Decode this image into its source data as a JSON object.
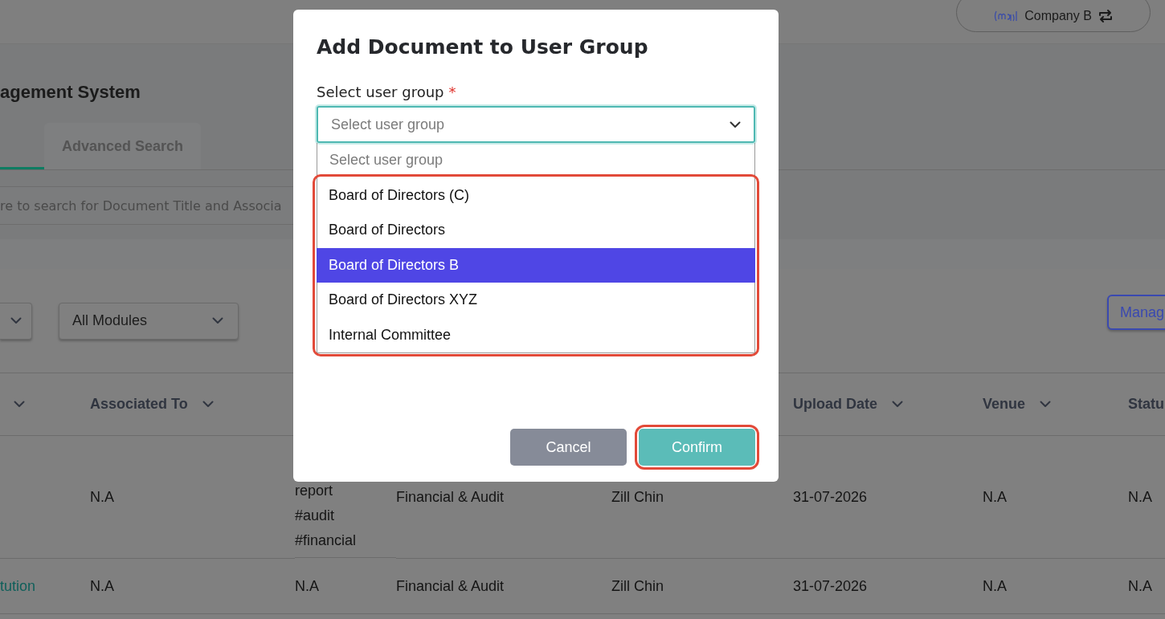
{
  "header": {
    "company": "Company B"
  },
  "page": {
    "title": "agement System",
    "tabs": [
      {
        "selected": true
      },
      {
        "label": "Advanced Search",
        "selected": false
      }
    ],
    "search": {
      "placeholder": "re to search for Document Title and Associa"
    },
    "module_filter": {
      "value": "All Modules"
    },
    "manage_button": "Manag"
  },
  "table": {
    "columns": [
      {
        "sortable": true
      },
      {
        "label": "Associated To",
        "sortable": true
      },
      {},
      {},
      {},
      {
        "label": "Upload Date",
        "sortable": true
      },
      {
        "label": "Venue",
        "sortable": true
      },
      {
        "label": "Statu",
        "sortable": false
      }
    ],
    "rows": [
      {
        "cells": [
          null,
          {
            "text": "N.A",
            "kind": "text"
          },
          {
            "text": "report\n#audit\n#financial",
            "kind": "text"
          },
          {
            "text": "Financial & Audit",
            "kind": "text"
          },
          {
            "text": "Zill Chin",
            "kind": "text"
          },
          {
            "text": "31-07-2026",
            "kind": "text"
          },
          {
            "text": "N.A",
            "kind": "text"
          },
          {
            "text": "N.A",
            "kind": "text"
          }
        ]
      },
      {
        "cells": [
          {
            "text": "tution",
            "kind": "link"
          },
          {
            "text": "N.A",
            "kind": "text"
          },
          {
            "text": "N.A",
            "kind": "text"
          },
          {
            "text": "Financial & Audit",
            "kind": "text"
          },
          {
            "text": "Zill Chin",
            "kind": "text"
          },
          {
            "text": "31-07-2026",
            "kind": "text"
          },
          {
            "text": "N.A",
            "kind": "text"
          },
          {
            "text": "N.A",
            "kind": "text"
          }
        ]
      }
    ]
  },
  "modal": {
    "title": "Add Document to User Group",
    "field_label": "Select user group",
    "required_mark": "*",
    "select": {
      "placeholder": "Select user group",
      "expanded": true
    },
    "options_highlighted": true,
    "options": [
      {
        "label": "Select user group",
        "kind": "placeholder",
        "selected": false
      },
      {
        "label": "Board of Directors (C)",
        "kind": "group",
        "selected": false
      },
      {
        "label": "Board of Directors",
        "kind": "group",
        "selected": false
      },
      {
        "label": "Board of Directors B",
        "kind": "group",
        "selected": true
      },
      {
        "label": "Board of Directors XYZ",
        "kind": "group",
        "selected": false
      },
      {
        "label": "Internal Committee",
        "kind": "group",
        "selected": false
      }
    ],
    "buttons": [
      {
        "label": "Cancel",
        "kind": "secondary",
        "highlighted": false
      },
      {
        "label": "Confirm",
        "kind": "primary",
        "highlighted": true
      }
    ]
  }
}
